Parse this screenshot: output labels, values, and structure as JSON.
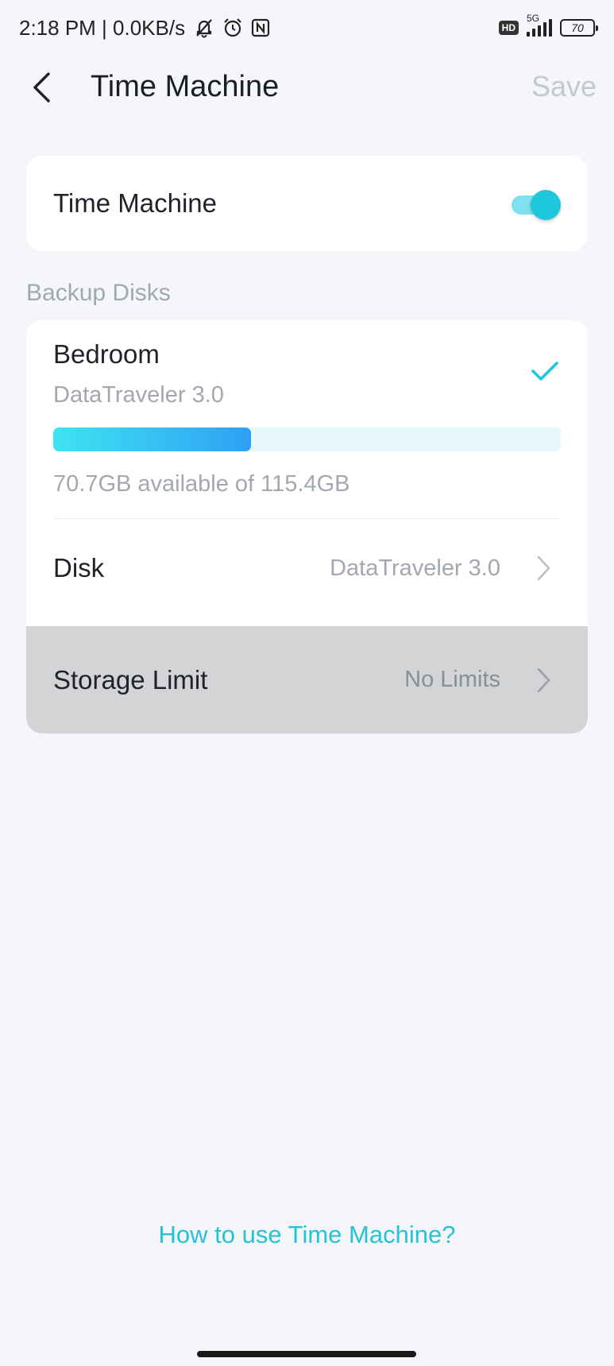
{
  "status_bar": {
    "time_speed": "2:18 PM | 0.0KB/s",
    "hd": "HD",
    "network": "5G",
    "battery": "70",
    "icons": [
      "muted-bell-icon",
      "alarm-icon",
      "nfc-icon"
    ]
  },
  "header": {
    "title": "Time Machine",
    "save_label": "Save"
  },
  "time_machine": {
    "label": "Time Machine",
    "enabled": true
  },
  "backup": {
    "section_label": "Backup Disks",
    "disk_name": "Bedroom",
    "disk_model": "DataTraveler 3.0",
    "used_fraction": 0.39,
    "capacity_text": "70.7GB available of 115.4GB"
  },
  "rows": {
    "disk": {
      "label": "Disk",
      "value": "DataTraveler 3.0"
    },
    "storage_limit": {
      "label": "Storage Limit",
      "value": "No Limits"
    }
  },
  "help_link": "How to use Time Machine?",
  "colors": {
    "accent": "#1ec6de",
    "progress_start": "#3ee4f2",
    "progress_end": "#2f9ff5"
  }
}
